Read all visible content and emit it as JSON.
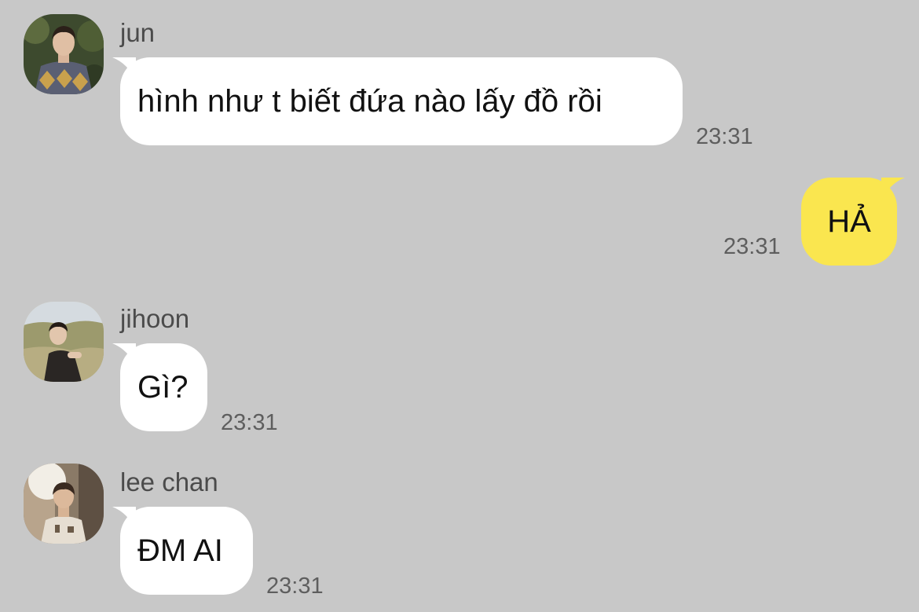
{
  "messages": [
    {
      "sender": "jun",
      "text": "hình như t biết đứa nào lấy đồ rồi",
      "time": "23:31"
    },
    {
      "sender": "",
      "text": "HẢ",
      "time": "23:31"
    },
    {
      "sender": "jihoon",
      "text": "Gì?",
      "time": "23:31"
    },
    {
      "sender": "lee chan",
      "text": "ĐM AI",
      "time": "23:31"
    }
  ],
  "colors": {
    "background": "#c8c8c8",
    "incoming_bubble": "#ffffff",
    "outgoing_bubble": "#fae64f",
    "sender_text": "#4b4b4b",
    "timestamp_text": "#5e5e5e"
  }
}
